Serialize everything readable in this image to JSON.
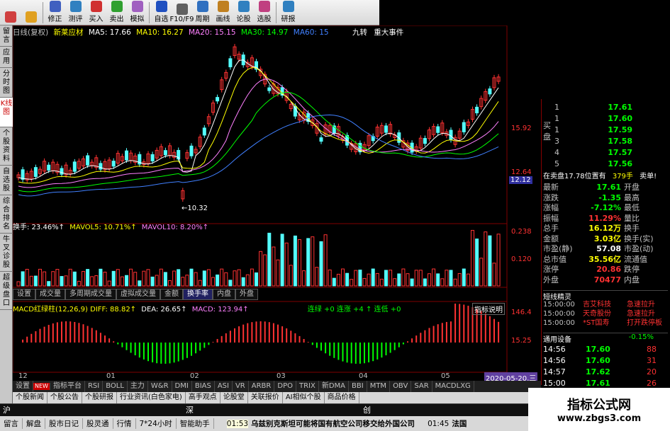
{
  "toolbar": {
    "buttons": [
      {
        "label": "",
        "icon": "nav-arrows-icon",
        "color": "#d04040"
      },
      {
        "label": "",
        "icon": "back-arrow-icon",
        "color": "#e0a020"
      },
      {
        "label": "修正",
        "icon": "edit-icon",
        "color": "#4060c0"
      },
      {
        "label": "测评",
        "icon": "evaluate-icon",
        "color": "#3080c0"
      },
      {
        "label": "买入",
        "icon": "buy-icon",
        "color": "#d03030"
      },
      {
        "label": "卖出",
        "icon": "sell-icon",
        "color": "#30a030"
      },
      {
        "label": "模拟",
        "icon": "simulate-icon",
        "color": "#a060c0"
      },
      {
        "label": "自选",
        "icon": "favorite-icon",
        "color": "#2050c0"
      },
      {
        "label": "F10/F9",
        "icon": "f10-icon",
        "color": "#606060"
      },
      {
        "label": "周期",
        "icon": "cycle-icon",
        "color": "#3070c0"
      },
      {
        "label": "画线",
        "icon": "draw-line-icon",
        "color": "#c08020"
      },
      {
        "label": "论股",
        "icon": "discuss-icon",
        "color": "#3080c0"
      },
      {
        "label": "选股",
        "icon": "screen-stock-icon",
        "color": "#c04080"
      },
      {
        "label": "研报",
        "icon": "report-icon",
        "color": "#3080c0"
      }
    ]
  },
  "left_tabs": [
    {
      "label": "留言"
    },
    {
      "label": "应用"
    },
    {
      "label": "分时图"
    },
    {
      "label": "K线图",
      "active": true
    },
    {
      "label": "个股资料"
    },
    {
      "label": "自选股"
    },
    {
      "label": "综合排名"
    },
    {
      "label": "牛叉诊股"
    },
    {
      "label": "超级盘口"
    }
  ],
  "title": {
    "mode": "日线(复权)",
    "name": "新莱应材",
    "ma5": "MA5: 17.66",
    "ma10": "MA10: 16.27",
    "ma20": "MA20: 15.15",
    "ma30": "MA30: 14.97",
    "ma60": "MA60: 15",
    "event1": "九转",
    "event2": "重大事件"
  },
  "price_axis": {
    "high": "15.92",
    "low": "12.64",
    "current": "12.12",
    "marker": "←10.32"
  },
  "vol_title": {
    "label": "换手: 23.46%↑",
    "mavol5": "MAVOL5: 10.71%↑",
    "mavol10": "MAVOL10: 8.20%↑"
  },
  "vol_axis": {
    "top": "0.238",
    "mid": "0.120"
  },
  "sub_tabs": [
    "设置",
    "成交量",
    "多周期成交量",
    "虚拟成交量",
    "金额",
    "换手率",
    "内盘",
    "外盘"
  ],
  "macd": {
    "title": "MACD红绿柱(12,26,9) DIFF: 88.82↑",
    "dea": "DEA: 26.65↑",
    "macd": "MACD: 123.94↑",
    "extra": "连绿 +0  连涨 +4 ↑  连低 +0",
    "help": "指标说明",
    "axis_top": "146.4",
    "axis_bottom": "15.25"
  },
  "date_axis": [
    "12",
    "01",
    "02",
    "03",
    "04",
    "05"
  ],
  "date_current": "2020-05-20,三",
  "indicator_tabs": [
    "设置",
    "NEW",
    "指标平台",
    "RSI",
    "BOLL",
    "主力",
    "W&R",
    "DMI",
    "BIAS",
    "ASI",
    "VR",
    "ARBR",
    "DPO",
    "TRIX",
    "新DMA",
    "BBI",
    "MTM",
    "OBV",
    "SAR",
    "MACDLXG"
  ],
  "info_tabs": [
    "个股新闻",
    "个股公告",
    "个股研报",
    "行业资讯(白色家电)",
    "高手观点",
    "论股堂",
    "关联报价",
    "AI相似个股",
    "商品价格"
  ],
  "order_book": {
    "buy_label": "买盘",
    "rows": [
      {
        "n": "1",
        "price": "17.61"
      },
      {
        "n": "1",
        "price": "17.60"
      },
      {
        "n": "1",
        "price": "17.59"
      },
      {
        "n": "3",
        "price": "17.58"
      },
      {
        "n": "4",
        "price": "17.57"
      },
      {
        "n": "5",
        "price": "17.56"
      }
    ],
    "sell_line": {
      "label": "在卖盘17.78位置有",
      "qty": "379手",
      "action": "卖单!"
    }
  },
  "quote": [
    {
      "k": "最新",
      "v": "17.61",
      "k2": "开盘"
    },
    {
      "k": "涨跌",
      "v": "-1.35",
      "k2": "最高"
    },
    {
      "k": "涨幅",
      "v": "-7.12%",
      "k2": "最低"
    },
    {
      "k": "振幅",
      "v": "11.29%",
      "k2": "量比"
    },
    {
      "k": "总手",
      "v": "16.12万",
      "k2": "换手"
    },
    {
      "k": "金额",
      "v": "3.03亿",
      "k2": "换手(实)"
    },
    {
      "k": "市盈(静)",
      "v": "57.08",
      "k2": "市盈(动)"
    },
    {
      "k": "总市值",
      "v": "35.56亿",
      "k2": "流通值"
    },
    {
      "k": "涨停",
      "v": "20.86",
      "k2": "跌停"
    },
    {
      "k": "外盘",
      "v": "70477",
      "k2": "内盘"
    }
  ],
  "short_wizard": {
    "title": "短线精灵",
    "rows": [
      {
        "t": "15:00:00",
        "name": "吉艾科技",
        "ev": "急速拉升"
      },
      {
        "t": "15:00:00",
        "name": "天奇股份",
        "ev": "急速拉升"
      },
      {
        "t": "15:00:00",
        "name": "*ST国寿",
        "ev": "打开跌停板"
      }
    ]
  },
  "common_equipment": {
    "label": "通用设备",
    "change": "-0.15%"
  },
  "ticks": [
    {
      "t": "14:56",
      "p": "17.60",
      "v": "88"
    },
    {
      "t": "14:56",
      "p": "17.60",
      "v": "31"
    },
    {
      "t": "14:57",
      "p": "17.62",
      "v": "20"
    },
    {
      "t": "15:00",
      "p": "17.61",
      "v": "26"
    }
  ],
  "index_bar": {
    "sh": "沪",
    "sz": "深",
    "cy": "创"
  },
  "status": {
    "items": [
      "留言",
      "解盘",
      "股市日记",
      "股灵通",
      "行情",
      "7*24小时",
      "智能助手"
    ],
    "time1": "01:53",
    "news1": "乌兹别克斯坦可能将国有航空公司移交给外国公司",
    "time2": "01:45",
    "news2": "法国"
  },
  "watermark": {
    "title": "指标公式网",
    "url": "www.zbgs3.com"
  },
  "colors": {
    "up": "#ff3232",
    "down": "#54ffff",
    "ma5": "#ffffff",
    "ma10": "#ffff00",
    "ma20": "#ff80ff",
    "ma30": "#00ff00",
    "ma60": "#4080ff",
    "grid": "#600000"
  }
}
